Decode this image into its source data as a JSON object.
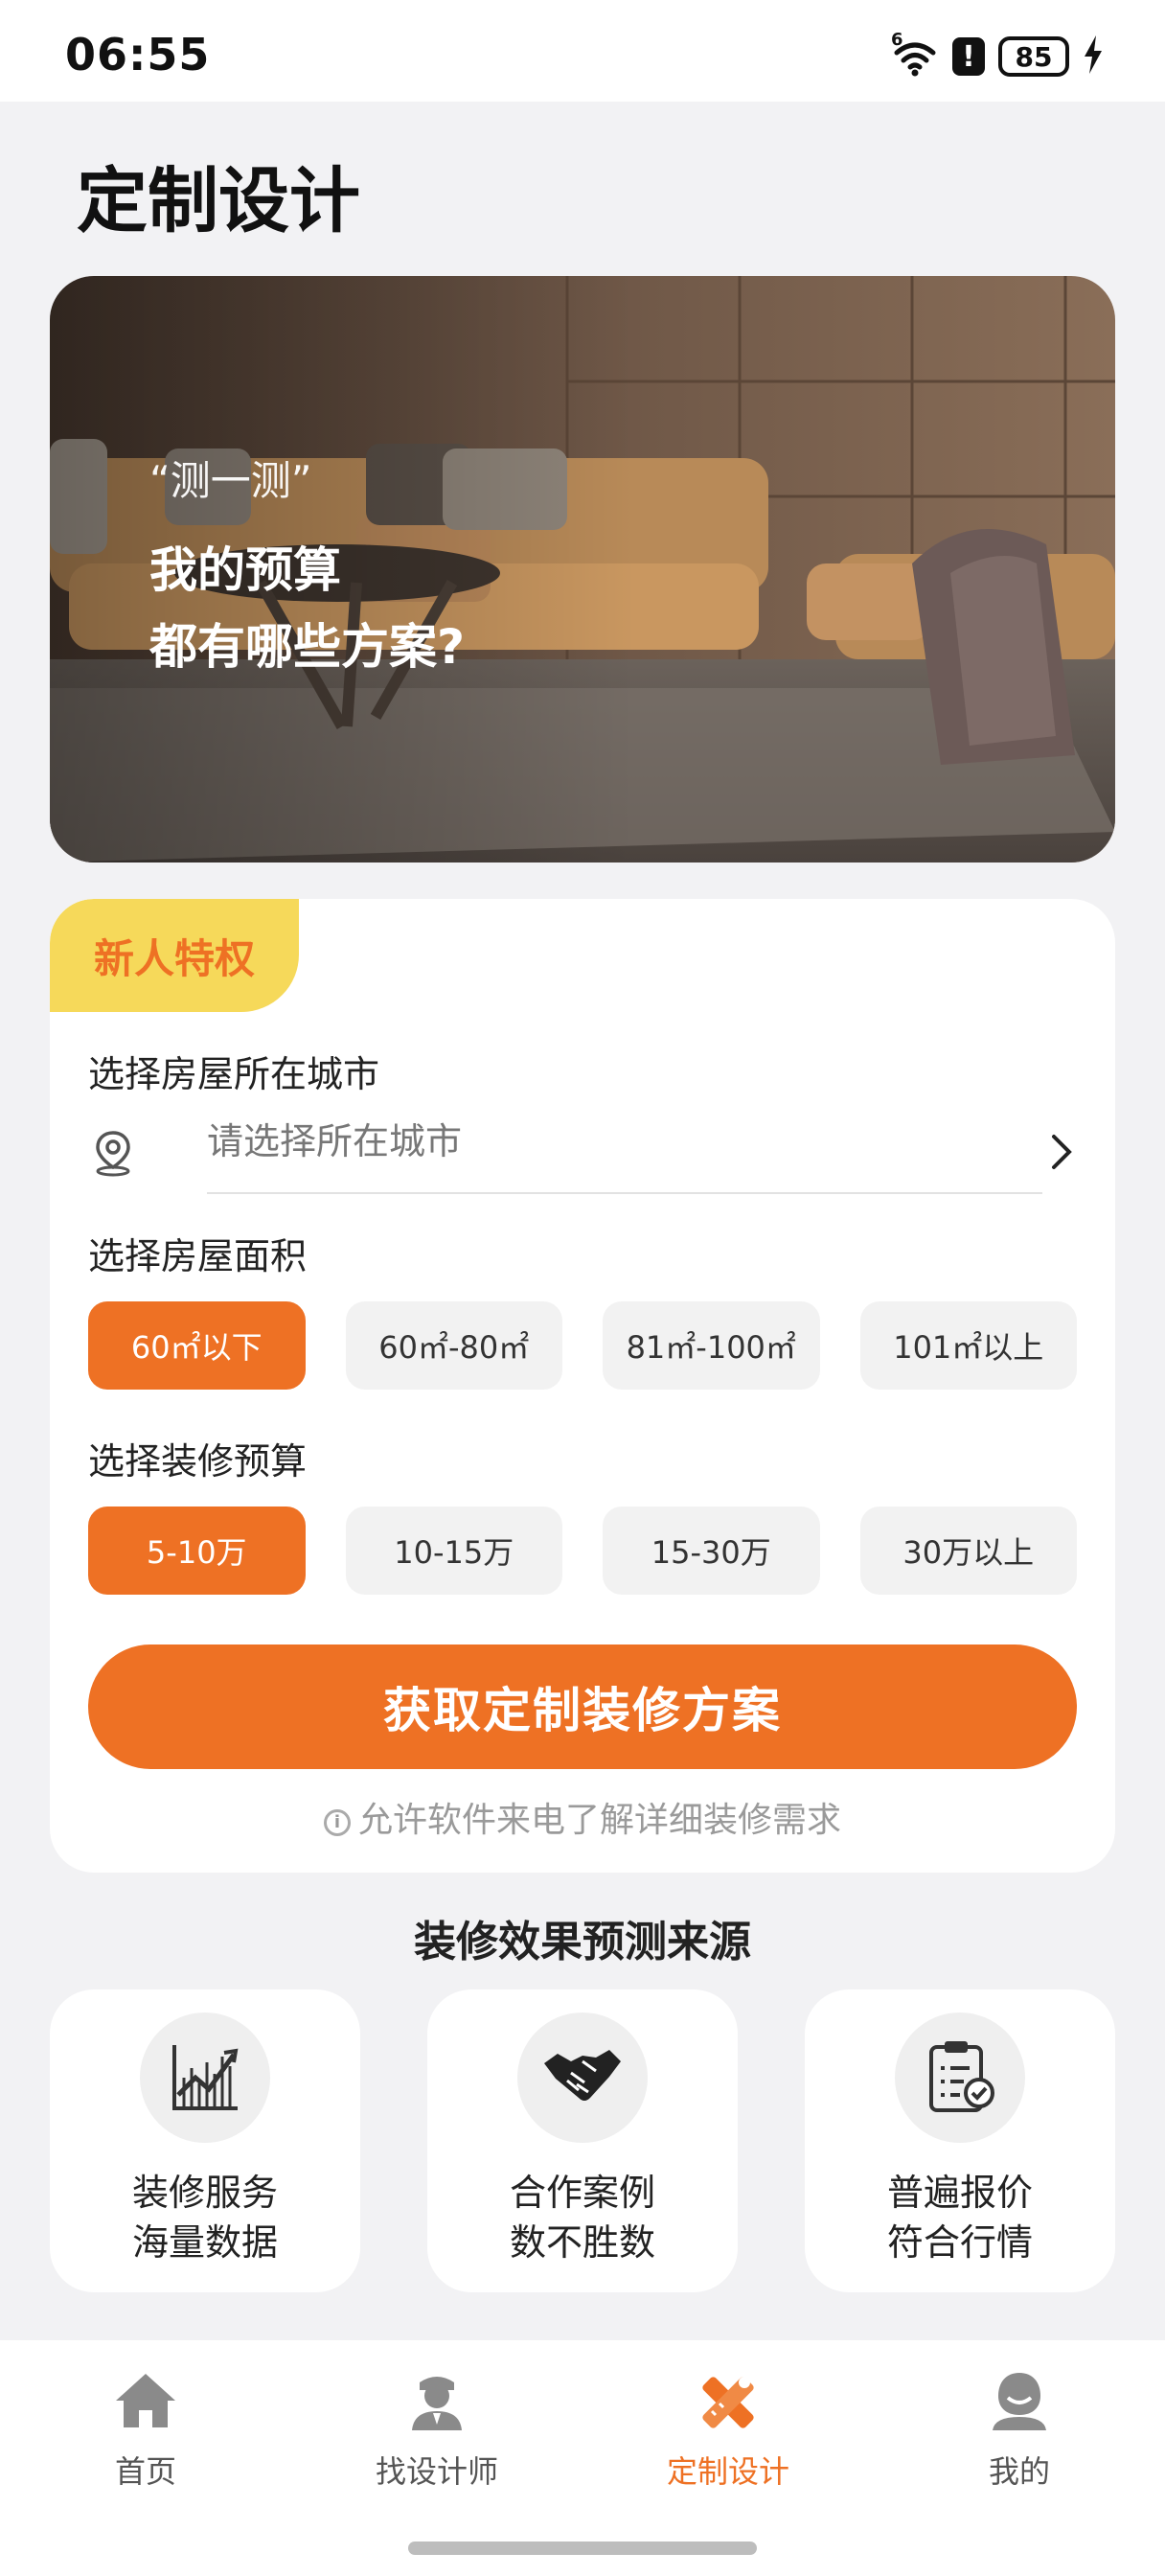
{
  "status_bar": {
    "time": "06:55",
    "network": "6",
    "battery": "85",
    "icons": [
      "wifi-icon",
      "alert-icon",
      "battery-icon",
      "charging-icon"
    ]
  },
  "page": {
    "title": "定制设计"
  },
  "banner": {
    "quote": "“测一测”",
    "line1": "我的预算",
    "line2": "都有哪些方案?"
  },
  "form": {
    "badge": "新人特权",
    "city_label": "选择房屋所在城市",
    "city_placeholder": "请选择所在城市",
    "area_label": "选择房屋面积",
    "area_options": [
      "60㎡以下",
      "60㎡-80㎡",
      "81㎡-100㎡",
      "101㎡以上"
    ],
    "area_selected": "60㎡以下",
    "budget_label": "选择装修预算",
    "budget_options": [
      "5-10万",
      "10-15万",
      "15-30万",
      "30万以上"
    ],
    "budget_selected": "5-10万",
    "cta": "获取定制装修方案",
    "hint": "允许软件来电了解详细装修需求"
  },
  "sources": {
    "title": "装修效果预测来源",
    "items": [
      {
        "line1": "装修服务",
        "line2": "海量数据",
        "icon": "chart-icon"
      },
      {
        "line1": "合作案例",
        "line2": "数不胜数",
        "icon": "handshake-icon"
      },
      {
        "line1": "普遍报价",
        "line2": "符合行情",
        "icon": "clipboard-icon"
      }
    ]
  },
  "tabbar": {
    "items": [
      {
        "label": "首页",
        "icon": "home-icon"
      },
      {
        "label": "找设计师",
        "icon": "designer-icon"
      },
      {
        "label": "定制设计",
        "icon": "custom-design-icon"
      },
      {
        "label": "我的",
        "icon": "profile-icon"
      }
    ],
    "active": "定制设计"
  },
  "colors": {
    "accent": "#ee7124",
    "badge_bg": "#f6d95a",
    "background": "#f2f2f4"
  }
}
